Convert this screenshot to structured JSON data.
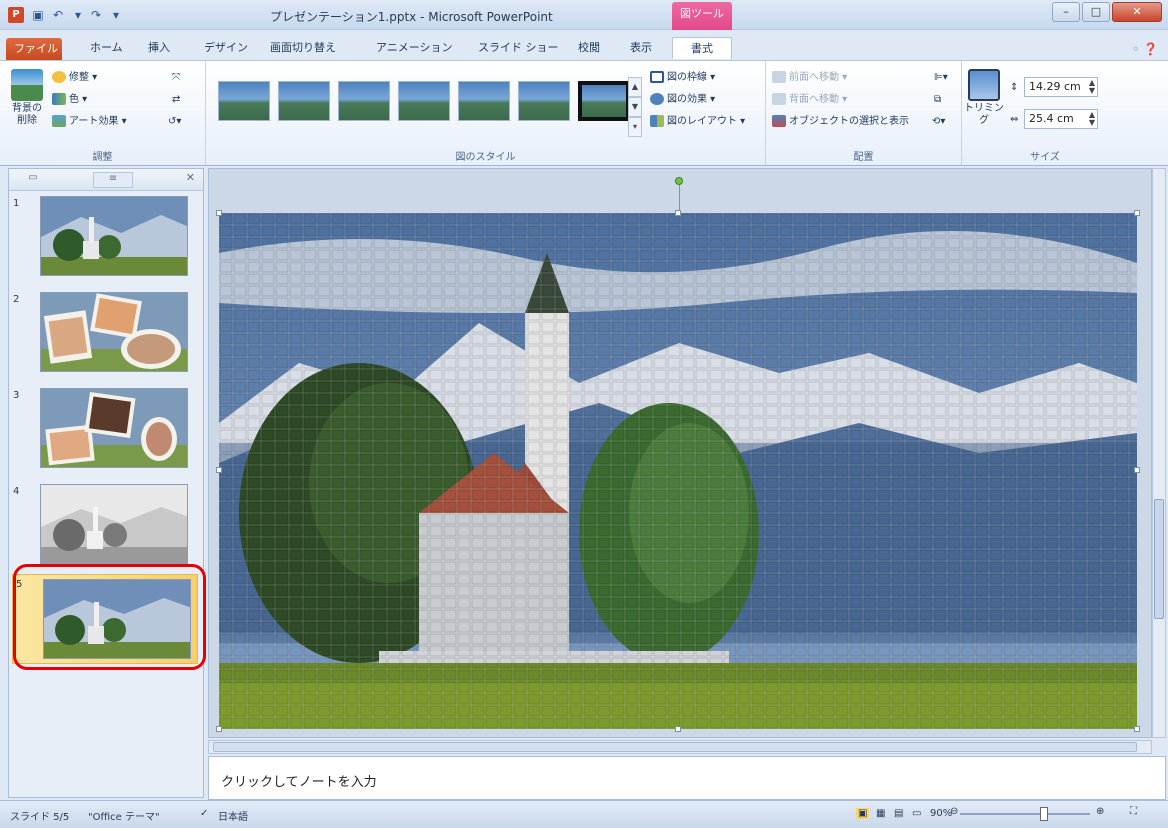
{
  "window": {
    "title": "プレゼンテーション1.pptx - Microsoft PowerPoint",
    "context_tab": "図ツール",
    "app_icon": "P"
  },
  "tabs": [
    "ファイル",
    "ホーム",
    "挿入",
    "デザイン",
    "画面切り替え",
    "アニメーション",
    "スライド ショー",
    "校閲",
    "表示",
    "書式"
  ],
  "ribbon": {
    "adjust": {
      "remove_bg_line1": "背景の",
      "remove_bg_line2": "削除",
      "corrections": "修整 ▾",
      "color": "色 ▾",
      "artistic": "アート効果 ▾",
      "label": "調整"
    },
    "picture_styles": {
      "border": "図の枠線 ▾",
      "effects": "図の効果 ▾",
      "layout": "図のレイアウト ▾",
      "label": "図のスタイル"
    },
    "arrange": {
      "bring_forward": "前面へ移動 ▾",
      "send_backward": "背面へ移動 ▾",
      "selection_pane": "オブジェクトの選択と表示",
      "label": "配置"
    },
    "size": {
      "crop": "トリミング",
      "height": "14.29 cm",
      "width": "25.4 cm",
      "label": "サイズ"
    }
  },
  "slides": [
    {
      "num": "1",
      "kind": "church"
    },
    {
      "num": "2",
      "kind": "photos"
    },
    {
      "num": "3",
      "kind": "photos"
    },
    {
      "num": "4",
      "kind": "church-gray"
    },
    {
      "num": "5",
      "kind": "church",
      "selected": true
    }
  ],
  "notes_placeholder": "クリックしてノートを入力",
  "status": {
    "slide_index": "スライド 5/5",
    "theme": "\"Office テーマ\"",
    "language": "日本語",
    "zoom": "90%"
  },
  "colors": {
    "file_tab": "#c54a1f",
    "context_tab": "#e2488a",
    "selection_ring": "#e60000",
    "selected_slide": "#f6cf6b"
  }
}
